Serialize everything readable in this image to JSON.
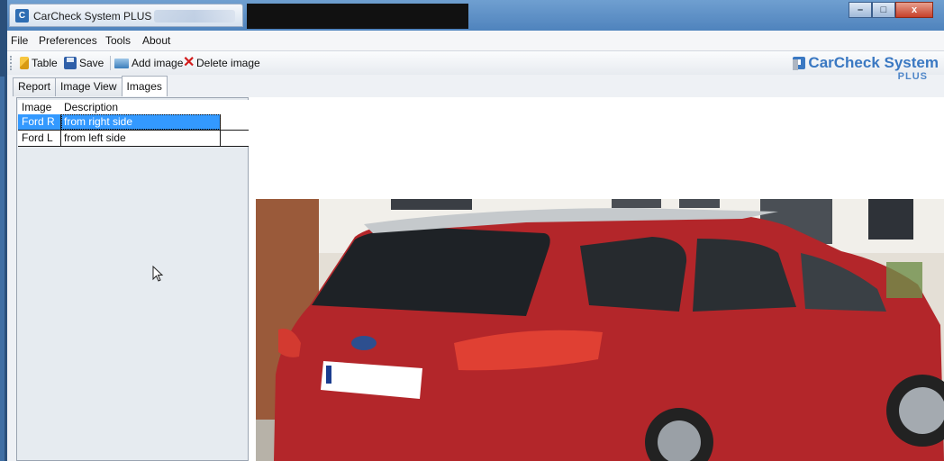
{
  "window": {
    "title": "CarCheck System PLUS",
    "controls": {
      "minimize": "–",
      "maximize": "□",
      "close": "x"
    }
  },
  "menu": {
    "items": [
      "File",
      "Preferences",
      "Tools",
      "About"
    ]
  },
  "toolbar": {
    "table_label": "Table",
    "save_label": "Save",
    "add_image_label": "Add image",
    "delete_image_label": "Delete image"
  },
  "brand": {
    "name": "CarCheck System",
    "suffix": "PLUS"
  },
  "tabs": {
    "items": [
      "Report",
      "Image View",
      "Images"
    ],
    "active": "Images"
  },
  "images_table": {
    "columns": [
      "Image",
      "Description"
    ],
    "rows": [
      {
        "image": "Ford R",
        "description": "from right side",
        "selected": true
      },
      {
        "image": "Ford L",
        "description": "from left side",
        "selected": false
      }
    ]
  },
  "colors": {
    "selection": "#3399ff",
    "brand": "#3a78c2",
    "car": "#b3262a"
  }
}
